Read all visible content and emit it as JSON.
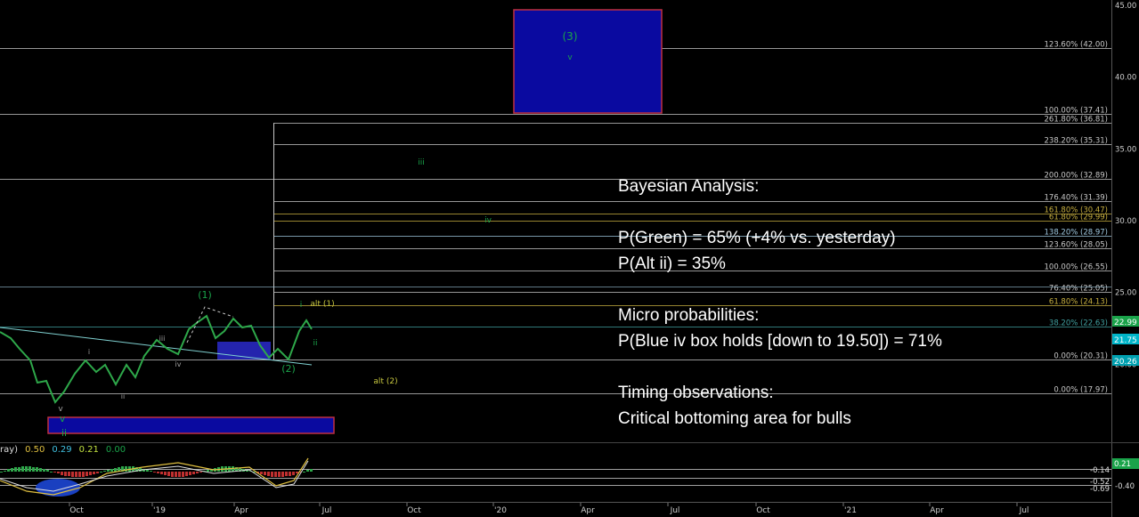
{
  "chart_data": {
    "type": "line",
    "y_axis": {
      "ticks": [
        "45.00",
        "40.00",
        "35.00",
        "30.00",
        "25.00",
        "20.00"
      ],
      "range": [
        16.5,
        45.5
      ]
    },
    "x_axis": {
      "ticks": [
        "Oct",
        "'19",
        "Apr",
        "Jul",
        "Oct",
        "'20",
        "Apr",
        "Jul",
        "Oct",
        "'21",
        "Apr",
        "Jul"
      ]
    },
    "grid": false,
    "fib_levels": [
      {
        "label": "123.60% (42.00)",
        "y": 42.0,
        "color": "#c8c8c8"
      },
      {
        "label": "100.00% (37.41)",
        "y": 37.41,
        "color": "#c8c8c8"
      },
      {
        "label": "261.80% (36.81)",
        "y": 36.81,
        "color": "#c8c8c8"
      },
      {
        "label": "238.20% (35.31)",
        "y": 35.31,
        "color": "#c8c8c8"
      },
      {
        "label": "200.00% (32.89)",
        "y": 32.89,
        "color": "#c8c8c8"
      },
      {
        "label": "176.40% (31.39)",
        "y": 31.39,
        "color": "#c8c8c8"
      },
      {
        "label": "161.80% (30.47)",
        "y": 30.47,
        "color": "#c8b040"
      },
      {
        "label": "61.80% (29.99)",
        "y": 29.99,
        "color": "#c8b040"
      },
      {
        "label": "138.20% (28.97)",
        "y": 28.97,
        "color": "#9fc8e0"
      },
      {
        "label": "123.60% (28.05)",
        "y": 28.05,
        "color": "#c8c8c8"
      },
      {
        "label": "100.00% (26.55)",
        "y": 26.55,
        "color": "#c8c8c8"
      },
      {
        "label": "76.40% (25.05)",
        "y": 25.05,
        "color": "#c8c8c8"
      },
      {
        "label": "61.80% (24.13)",
        "y": 24.13,
        "color": "#c8b040"
      },
      {
        "label": "38.20% (22.63)",
        "y": 22.63,
        "color": "#40a0a0"
      },
      {
        "label": "0.00% (20.31)",
        "y": 20.31,
        "color": "#c8c8c8"
      },
      {
        "label": "0.00% (17.97)",
        "y": 17.97,
        "color": "#c8c8c8"
      }
    ],
    "price_tags": [
      {
        "label": "22.99",
        "y": 22.99,
        "color": "#1aa34a"
      },
      {
        "label": "21.75",
        "y": 21.75,
        "color": "#00b4c8"
      },
      {
        "label": "20.26",
        "y": 20.26,
        "color": "#00a0b0"
      }
    ],
    "wave_labels": [
      {
        "label": "(3)",
        "color": "#1aa34a"
      },
      {
        "label": "v",
        "color": "#1aa34a"
      },
      {
        "label": "iii",
        "color": "#1aa34a"
      },
      {
        "label": "iv",
        "color": "#1aa34a"
      },
      {
        "label": "(1)",
        "color": "#1aa34a"
      },
      {
        "label": "(2)",
        "color": "#1aa34a"
      },
      {
        "label": "i",
        "color": "#1aa34a"
      },
      {
        "label": "ii",
        "color": "#1aa34a"
      },
      {
        "label": "alt (1)",
        "color": "#c8c840"
      },
      {
        "label": "alt (2)",
        "color": "#c8c840"
      },
      {
        "label": "v",
        "color": "#a0a0a0"
      },
      {
        "label": "i",
        "color": "#a0a0a0"
      },
      {
        "label": "ii",
        "color": "#a0a0a0"
      },
      {
        "label": "iii",
        "color": "#a0a0a0"
      },
      {
        "label": "iv",
        "color": "#a0a0a0"
      },
      {
        "label": "v",
        "color": "#1aa34a"
      },
      {
        "label": "ii",
        "color": "#1aa34a"
      }
    ],
    "oscillator": {
      "legend": [
        "ray)",
        "0.50",
        "0.29",
        "0.21",
        "0.00"
      ],
      "legend_colors": [
        "#dddddd",
        "#e0c040",
        "#40c0e0",
        "#c0e040",
        "#1aa34a"
      ],
      "tags": [
        {
          "label": "0.21",
          "color": "#1aa34a"
        },
        {
          "label": "-0.14",
          "color": "#dddddd"
        },
        {
          "label": "-0.40",
          "color": "#dddddd"
        },
        {
          "label": "-0.52",
          "color": "#dddddd"
        },
        {
          "label": "-0.69",
          "color": "#dddddd"
        }
      ]
    }
  },
  "analysis": {
    "title": "Bayesian Analysis:",
    "p_green": "P(Green) = 65% (+4% vs. yesterday)",
    "p_alt": "P(Alt ii) = 35%",
    "micro_title": "Micro probabilities:",
    "micro_line": "P(Blue iv box holds [down to 19.50]) = 71%",
    "timing_title": "Timing observations:",
    "timing_line": "Critical bottoming area for bulls"
  }
}
